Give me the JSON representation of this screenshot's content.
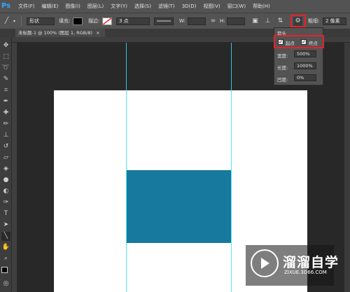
{
  "app": {
    "logo": "Ps"
  },
  "menu": {
    "items": [
      "文件(F)",
      "编辑(E)",
      "图像(I)",
      "图层(L)",
      "文字(Y)",
      "选择(S)",
      "滤镜(T)",
      "3D(D)",
      "视图(V)",
      "窗口(W)",
      "帮助(H)"
    ]
  },
  "options": {
    "mode": "形状",
    "fill_label": "填充:",
    "stroke_label": "描边:",
    "stroke_width": "3 点",
    "w_label": "W:",
    "h_label": "H:",
    "weight_label": "粗细:",
    "weight_value": "2 像素"
  },
  "document": {
    "tab_title": "未标题-1 @ 100% (图层 1, RGB/8)"
  },
  "arrowheads_popup": {
    "title": "箭头",
    "start_label": "起点",
    "end_label": "终点",
    "start_checked": true,
    "end_checked": true,
    "width_label": "宽度:",
    "width_value": "500%",
    "length_label": "长度:",
    "length_value": "1000%",
    "concavity_label": "凹度:",
    "concavity_value": "0%"
  },
  "colors": {
    "rectangle": "#17799e",
    "guides": "#36e3f0",
    "highlight": "#e8202a"
  },
  "watermark": {
    "title": "溜溜自学",
    "url": "ZIXUE.3D66.COM"
  }
}
